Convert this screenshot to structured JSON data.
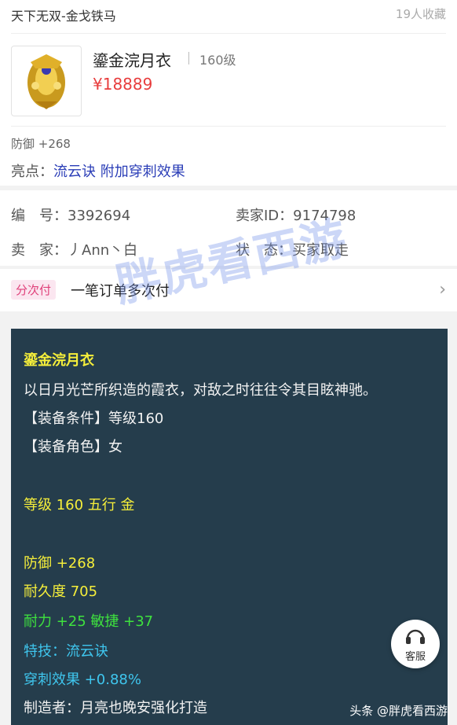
{
  "header": {
    "server": "天下无双-金戈铁马",
    "favorites": "19人收藏"
  },
  "item": {
    "name": "鎏金浣月衣",
    "level": "160级",
    "price": "¥18889",
    "defense": "防御 +268",
    "highlight_label": "亮点：",
    "highlight_value": "流云诀 附加穿刺效果"
  },
  "info": {
    "id": "编　号：3392694",
    "seller_id": "卖家ID：9174798",
    "seller": "卖　家：丿Ann丶白",
    "status": "状　态：买家取走"
  },
  "payment": {
    "badge": "分次付",
    "text": "一笔订单多次付"
  },
  "tooltip": {
    "title": "鎏金浣月衣",
    "desc": "以日月光芒所织造的霞衣，对敌之时往往令其目眩神驰。",
    "req": "【装备条件】等级160",
    "role": "【装备角色】女",
    "grade": "等级 160 五行 金",
    "def": "防御 +268",
    "dur": "耐久度 705",
    "stats": "耐力 +25 敏捷 +37",
    "skill": "特技：流云诀",
    "pierce": "穿刺效果 +0.88%",
    "maker": "制造者：月亮也晚安强化打造"
  },
  "service": {
    "label": "客服"
  },
  "watermark": "胖虎看西游",
  "source": "头条 @胖虎看西游",
  "colors": {
    "price": "#e83d3d",
    "highlight": "#2a3db7",
    "tooltip_bg": "#253d4c",
    "yellow": "#f6ef3a",
    "green": "#3ee23e",
    "cyan": "#3fc6ee"
  },
  "icons": {
    "chevron": "chevron-right-icon",
    "service": "headset-icon"
  }
}
